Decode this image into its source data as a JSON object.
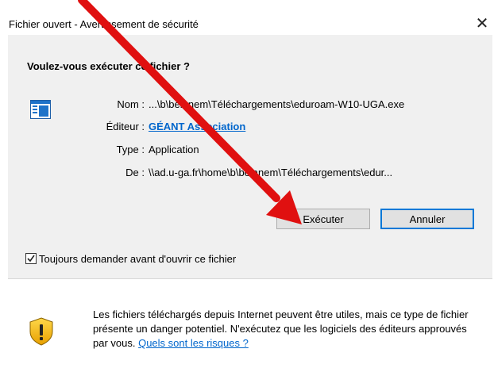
{
  "window": {
    "title": "Fichier ouvert - Avertissement de sécurité",
    "close_glyph": "✕"
  },
  "question": "Voulez-vous exécuter ce fichier ?",
  "fields": {
    "name_label": "Nom :",
    "name_value": "...\\b\\belanem\\Téléchargements\\eduroam-W10-UGA.exe",
    "publisher_label": "Éditeur :",
    "publisher_value": "GÉANT Association",
    "type_label": "Type :",
    "type_value": "Application",
    "from_label": "De :",
    "from_value": "\\\\ad.u-ga.fr\\home\\b\\belanem\\Téléchargements\\edur..."
  },
  "buttons": {
    "run": "Exécuter",
    "cancel": "Annuler"
  },
  "checkbox": {
    "label": "Toujours demander avant d'ouvrir ce fichier",
    "checked": true
  },
  "warning": {
    "text": "Les fichiers téléchargés depuis Internet peuvent être utiles, mais ce type de fichier présente un danger potentiel. N'exécutez que les logiciels des éditeurs approuvés par vous. ",
    "link": "Quels sont les risques ?"
  },
  "icons": {
    "app": "application-icon",
    "shield": "warning-shield-icon",
    "arrow": "red-arrow-annotation"
  },
  "colors": {
    "accent": "#0078d7",
    "link": "#0066cc",
    "arrow": "#e01010",
    "panel": "#f0f0f0"
  }
}
